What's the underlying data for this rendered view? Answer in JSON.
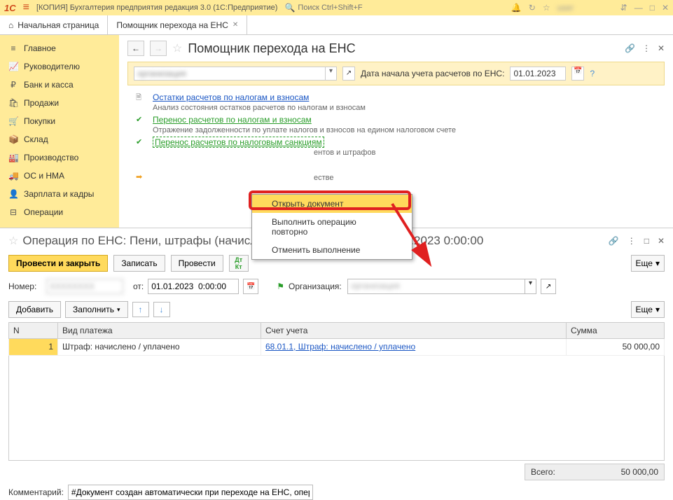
{
  "topbar": {
    "logo": "1C",
    "app_title": "[КОПИЯ] Бухгалтерия предприятия        редакция 3.0   (1С:Предприятие)",
    "search_placeholder": "Поиск Ctrl+Shift+F"
  },
  "tabs": {
    "home": "Начальная страница",
    "assistant": "Помощник перехода на ЕНС"
  },
  "sidebar": {
    "items": [
      {
        "icon": "≡",
        "label": "Главное"
      },
      {
        "icon": "📈",
        "label": "Руководителю"
      },
      {
        "icon": "₽",
        "label": "Банк и касса"
      },
      {
        "icon": "🛍",
        "label": "Продажи"
      },
      {
        "icon": "🛒",
        "label": "Покупки"
      },
      {
        "icon": "📦",
        "label": "Склад"
      },
      {
        "icon": "🏭",
        "label": "Производство"
      },
      {
        "icon": "🚚",
        "label": "ОС и НМА"
      },
      {
        "icon": "👤",
        "label": "Зарплата и кадры"
      },
      {
        "icon": "⊟",
        "label": "Операции"
      }
    ]
  },
  "content": {
    "title": "Помощник перехода на ЕНС",
    "date_label": "Дата начала учета расчетов по ЕНС:",
    "date_value": "01.01.2023",
    "steps": {
      "s1": {
        "link": "Остатки расчетов по налогам и взносам",
        "desc": "Анализ состояния остатков расчетов по налогам и взносам"
      },
      "s2": {
        "link": "Перенос расчетов по налогам и взносам",
        "desc": "Отражение задолженности по уплате налогов и взносов на едином налоговом счете"
      },
      "s3": {
        "link": "Перенос расчетов по налоговым санкциям",
        "desc_suffix": "ентов и штрафов"
      },
      "s4": {
        "desc_suffix": "естве"
      }
    },
    "ctx": {
      "open": "Открыть документ",
      "repeat": "Выполнить операцию повторно",
      "cancel": "Отменить выполнение"
    }
  },
  "doc": {
    "title_prefix": "Операция по ЕНС: Пени, штрафы (начисление)",
    "title_suffix": "от 01.01.2023 0:00:00",
    "buttons": {
      "post_close": "Провести и закрыть",
      "save": "Записать",
      "post": "Провести",
      "more": "Еще",
      "add": "Добавить",
      "fill": "Заполнить"
    },
    "fields": {
      "number_label": "Номер:",
      "from_label": "от:",
      "date_value": "01.01.2023  0:00:00",
      "org_label": "Организация:"
    },
    "table": {
      "cols": {
        "n": "N",
        "type": "Вид платежа",
        "account": "Счет учета",
        "sum": "Сумма"
      },
      "rows": [
        {
          "n": "1",
          "type": "Штраф: начислено / уплачено",
          "account": "68.01.1, Штраф: начислено / уплачено",
          "sum": "50 000,00"
        }
      ]
    },
    "totals": {
      "label": "Всего:",
      "value": "50 000,00"
    },
    "comment": {
      "label": "Комментарий:",
      "value": "#Документ создан автоматически при переходе на ЕНС, операция"
    }
  }
}
